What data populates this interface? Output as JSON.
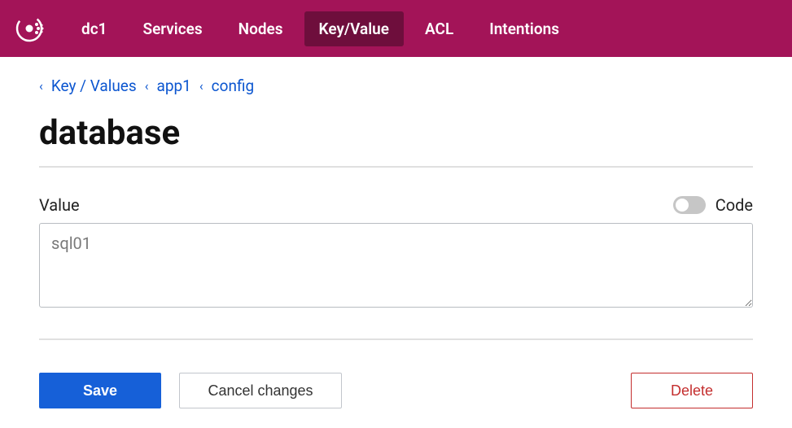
{
  "nav": {
    "items": [
      {
        "label": "dc1",
        "active": false
      },
      {
        "label": "Services",
        "active": false
      },
      {
        "label": "Nodes",
        "active": false
      },
      {
        "label": "Key/Value",
        "active": true
      },
      {
        "label": "ACL",
        "active": false
      },
      {
        "label": "Intentions",
        "active": false
      }
    ]
  },
  "breadcrumb": {
    "items": [
      {
        "label": "Key / Values"
      },
      {
        "label": "app1"
      },
      {
        "label": "config"
      }
    ]
  },
  "page": {
    "title": "database"
  },
  "form": {
    "value_label": "Value",
    "code_label": "Code",
    "value": "sql01"
  },
  "buttons": {
    "save": "Save",
    "cancel": "Cancel changes",
    "delete": "Delete"
  }
}
